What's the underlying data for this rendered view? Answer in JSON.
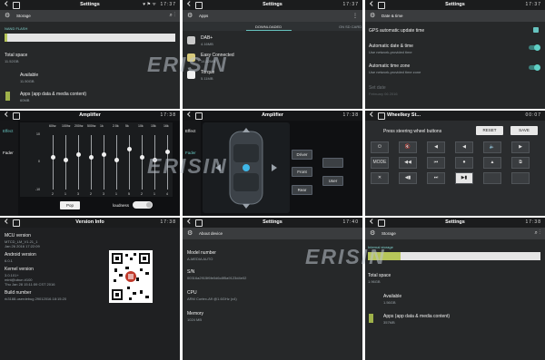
{
  "panel_storage1": {
    "status_time": "17:37",
    "status_icons": "♥ ⚑ ᯤ",
    "title": "Settings",
    "action_title": "Storage",
    "section_label": "NAND FLASH",
    "total_space_label": "Total space",
    "total_space_value": "11.52GB",
    "available_label": "Available",
    "available_value": "11.50GB",
    "apps_label": "Apps (app data & media content)",
    "apps_value": "60MB"
  },
  "panel_apps": {
    "status_time": "17:37",
    "title": "Settings",
    "action_title": "Apps",
    "tab_downloaded": "DOWNLOADED",
    "tab_sdcard": "ON SD CARD",
    "apps": [
      {
        "name": "DAB+",
        "size": "4.16MB"
      },
      {
        "name": "Easy Connected",
        "size": "14.32MB"
      },
      {
        "name": "Torque",
        "size": "5.11MB"
      }
    ]
  },
  "panel_date": {
    "status_time": "17:37",
    "title": "Settings",
    "action_title": "Date & time",
    "gps_label": "GPS automatic update time",
    "auto_date_label": "Automatic date & time",
    "auto_date_sub": "Use network-provided time",
    "auto_tz_label": "Automatic time zone",
    "auto_tz_sub": "Use network-provided time zone",
    "set_date_label": "Set date",
    "set_date_value": "February 06 2016"
  },
  "panel_eq": {
    "status_time": "17:38",
    "title": "Amplifier",
    "effect_label": "Effect",
    "fader_label": "Fader",
    "scale_top": "10",
    "scale_mid": "0",
    "scale_bot": "-10",
    "bands": [
      "60hz",
      "100hz",
      "200hz",
      "500hz",
      "1k",
      "2.5k",
      "5k",
      "10k",
      "15k",
      "16k"
    ],
    "band_values": [
      2,
      1,
      3,
      2,
      3,
      1,
      5,
      2,
      1,
      4
    ],
    "preset": "Pop",
    "loudness_label": "loudness"
  },
  "panel_fader": {
    "status_time": "17:38",
    "title": "Amplifier",
    "effect_label": "Effect",
    "fader_label": "Fader",
    "btn_driver": "Driver",
    "btn_front": "Front",
    "btn_rear": "Rear",
    "btn_user": "User"
  },
  "panel_wheel": {
    "status_time": "00:07",
    "title": "Wheelkey St...",
    "prompt": "Press steering wheel buttons",
    "btn_reset": "RESET",
    "btn_save": "SAVE",
    "tiles": [
      "⏻",
      "🔇",
      "◀︎",
      "◀",
      "🔈",
      "▶︎",
      "MODE",
      "◀◀",
      "⏮",
      "⏺",
      "▲",
      "⧉",
      "✕",
      "◀▮",
      "⏭",
      "▶▮",
      "",
      ""
    ]
  },
  "panel_version": {
    "status_time": "17:38",
    "title": "Version Info",
    "mcu_label": "MCU version",
    "mcu_value": "MTCD_LM_V1.21_1",
    "mcu_date": "Jan 26 2016   17:22:09",
    "android_label": "Android version",
    "android_value": "6.0.1",
    "kernel_label": "Kernel version",
    "kernel_value": "3.0.101+",
    "kernel_user": "mint@ubun #100",
    "kernel_date": "Thu Jan 28 15:11:59 CST 2016",
    "build_label": "Build number",
    "build_value": "rk3188-userdebug 29012016.18:15:20"
  },
  "panel_about": {
    "status_time": "17:40",
    "title": "Settings",
    "action_title": "About device",
    "model_label": "Model number",
    "model_value": "A-MEDIA AUTO",
    "sn_label": "S/N",
    "sn_value": "00316a2915f6fe0d6c8f5a9123d4e02",
    "cpu_label": "CPU",
    "cpu_value": "ARM Cortex-A9 @1.6GHz (x4)",
    "memory_label": "Memory",
    "memory_value": "1024 MB"
  },
  "panel_storage2": {
    "status_time": "17:38",
    "title": "Settings",
    "action_title": "Storage",
    "section_label": "Internal storage",
    "total_space_label": "Total space",
    "total_space_value": "1.96GB",
    "available_label": "Available",
    "available_value": "1.56GB",
    "apps_label": "Apps (app data & media content)",
    "apps_value": "357MB"
  },
  "watermark": "ERISIN",
  "colors": {
    "panel_bg": "#262829",
    "statusbar": "#1b1c1d",
    "actionbar": "#3a3c3e",
    "accent_teal": "#66c3bf",
    "storage_green": "#9fb24a"
  }
}
